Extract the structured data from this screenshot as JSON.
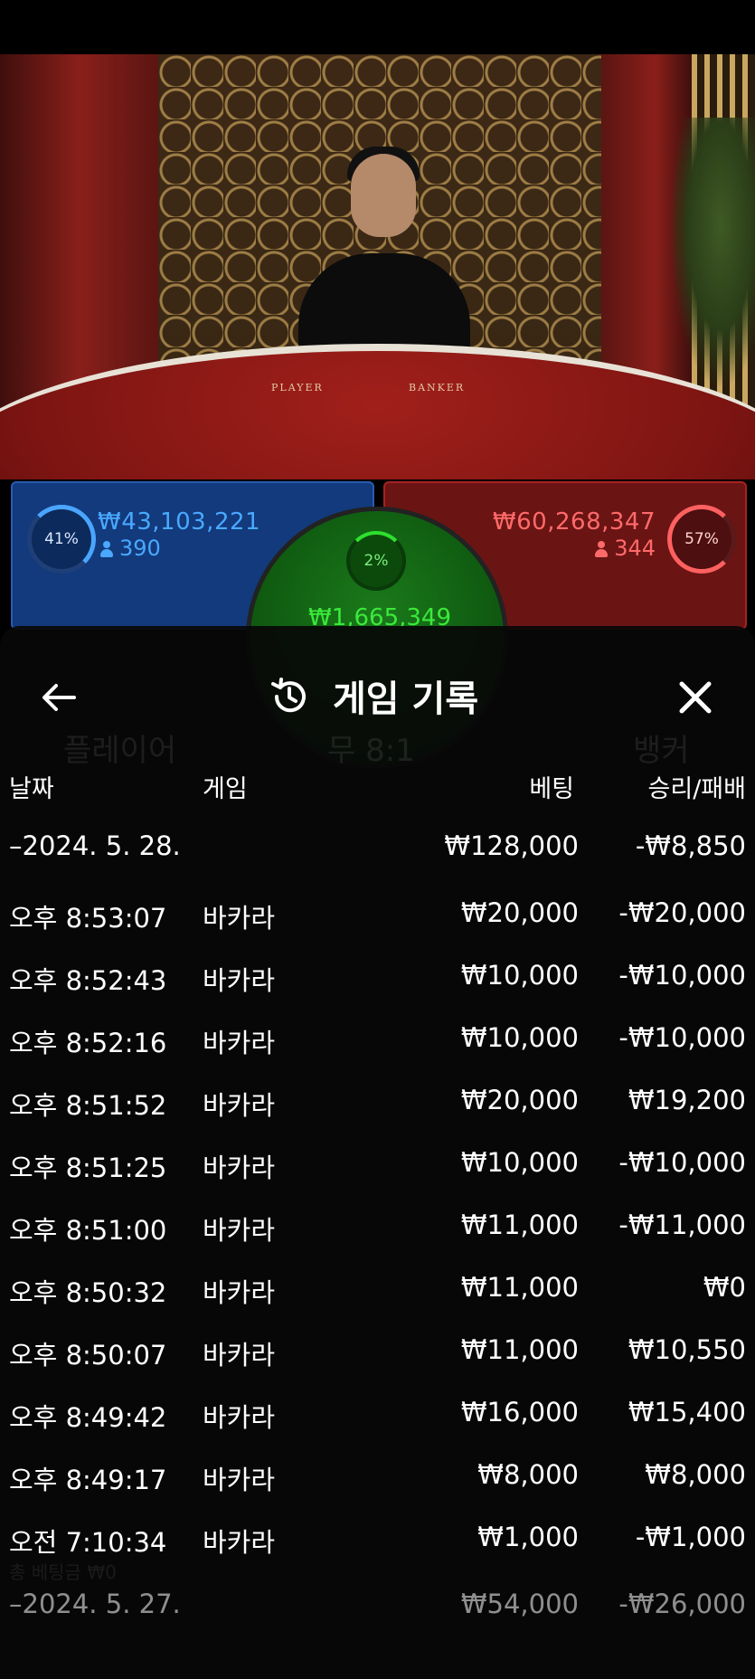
{
  "video": {
    "table_left_label": "PLAYER",
    "table_right_label": "BANKER"
  },
  "bet_panel": {
    "player": {
      "percent": "41%",
      "amount": "₩43,103,221",
      "players": "390",
      "color": "#4aa8ff"
    },
    "banker": {
      "percent": "57%",
      "amount": "₩60,268,347",
      "players": "344",
      "color": "#ff6a6a"
    },
    "tie": {
      "percent": "2%",
      "amount": "₩1,665,349",
      "color": "#3be93b"
    }
  },
  "sheet": {
    "title": "게임 기록",
    "headers": {
      "date": "날짜",
      "game": "게임",
      "bet": "베팅",
      "result": "승리/패배"
    },
    "day_summary": {
      "date": "–2024. 5. 28.",
      "bet": "₩128,000",
      "result": "-₩8,850"
    },
    "rows": [
      {
        "time": "오후 8:53:07",
        "game": "바카라",
        "bet": "₩20,000",
        "result": "-₩20,000"
      },
      {
        "time": "오후 8:52:43",
        "game": "바카라",
        "bet": "₩10,000",
        "result": "-₩10,000"
      },
      {
        "time": "오후 8:52:16",
        "game": "바카라",
        "bet": "₩10,000",
        "result": "-₩10,000"
      },
      {
        "time": "오후 8:51:52",
        "game": "바카라",
        "bet": "₩20,000",
        "result": "₩19,200"
      },
      {
        "time": "오후 8:51:25",
        "game": "바카라",
        "bet": "₩10,000",
        "result": "-₩10,000"
      },
      {
        "time": "오후 8:51:00",
        "game": "바카라",
        "bet": "₩11,000",
        "result": "-₩11,000"
      },
      {
        "time": "오후 8:50:32",
        "game": "바카라",
        "bet": "₩11,000",
        "result": "₩0"
      },
      {
        "time": "오후 8:50:07",
        "game": "바카라",
        "bet": "₩11,000",
        "result": "₩10,550"
      },
      {
        "time": "오후 8:49:42",
        "game": "바카라",
        "bet": "₩16,000",
        "result": "₩15,400"
      },
      {
        "time": "오후 8:49:17",
        "game": "바카라",
        "bet": "₩8,000",
        "result": "₩8,000"
      },
      {
        "time": "오전 7:10:34",
        "game": "바카라",
        "bet": "₩1,000",
        "result": "-₩1,000"
      }
    ],
    "next_day_summary": {
      "date": "–2024. 5. 27.",
      "bet": "₩54,000",
      "result": "-₩26,000"
    }
  },
  "background_overlay": {
    "player_label": "플레이어",
    "tie_label": "무 8:1",
    "banker_label": "뱅커",
    "total_bet_label": "총 베팅금 ₩0"
  },
  "icons": {
    "back": "arrow-left-icon",
    "history": "history-icon",
    "close": "close-icon"
  }
}
